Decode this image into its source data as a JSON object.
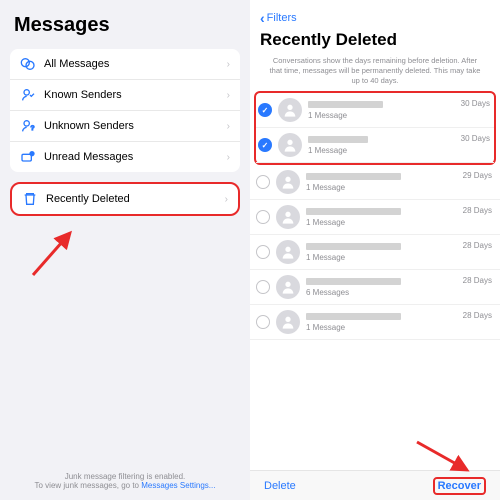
{
  "left": {
    "title": "Messages",
    "filters": [
      {
        "label": "All Messages"
      },
      {
        "label": "Known Senders"
      },
      {
        "label": "Unknown Senders"
      },
      {
        "label": "Unread Messages"
      }
    ],
    "recently_deleted_label": "Recently Deleted",
    "footer_line1": "Junk message filtering is enabled.",
    "footer_line2_prefix": "To view junk messages, go to ",
    "footer_link": "Messages Settings...",
    "colors": {
      "highlight": "#e82a2a",
      "link": "#2979ff"
    }
  },
  "right": {
    "back": "Filters",
    "title": "Recently Deleted",
    "description": "Conversations show the days remaining before deletion. After that time, messages will be permanently deleted. This may take up to 40 days.",
    "conversations": [
      {
        "count": "1 Message",
        "days": "30 Days",
        "checked": true,
        "name_width": 75
      },
      {
        "count": "1 Message",
        "days": "30 Days",
        "checked": true,
        "name_width": 60
      },
      {
        "count": "1 Message",
        "days": "29 Days",
        "checked": false,
        "name_width": 95
      },
      {
        "count": "1 Message",
        "days": "28 Days",
        "checked": false,
        "name_width": 95
      },
      {
        "count": "1 Message",
        "days": "28 Days",
        "checked": false,
        "name_width": 95
      },
      {
        "count": "6 Messages",
        "days": "28 Days",
        "checked": false,
        "name_width": 95
      },
      {
        "count": "1 Message",
        "days": "28 Days",
        "checked": false,
        "name_width": 95
      }
    ],
    "delete_label": "Delete",
    "recover_label": "Recover"
  }
}
